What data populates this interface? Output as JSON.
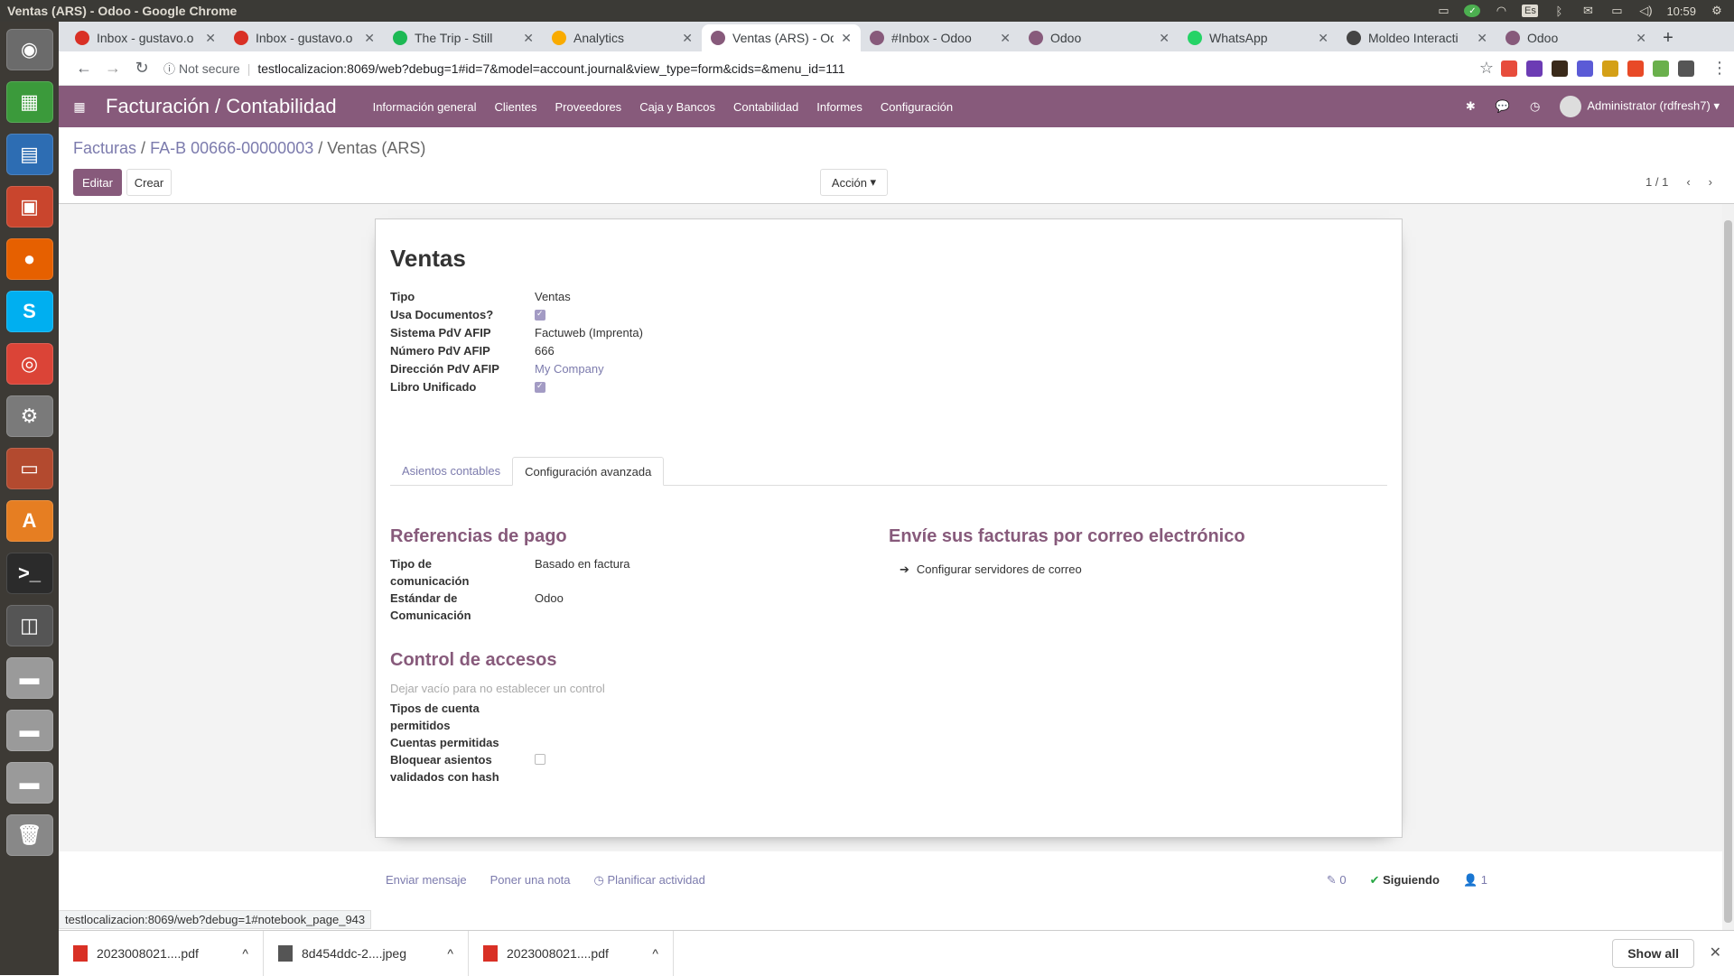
{
  "os": {
    "window_title": "Ventas (ARS) - Odoo - Google Chrome",
    "lang": "Es",
    "clock": "10:59"
  },
  "launcher": {
    "apps": [
      {
        "name": "dash-icon",
        "color": "#6b6b6b",
        "glyph": "◉"
      },
      {
        "name": "calc-icon",
        "color": "#3b9a3b",
        "glyph": "▦"
      },
      {
        "name": "writer-icon",
        "color": "#2d6db3",
        "glyph": "▤"
      },
      {
        "name": "impress-icon",
        "color": "#c9452d",
        "glyph": "▣"
      },
      {
        "name": "firefox-icon",
        "color": "#e66000",
        "glyph": "●"
      },
      {
        "name": "skype-icon",
        "color": "#00aff0",
        "glyph": "S"
      },
      {
        "name": "chrome-icon",
        "color": "#db4437",
        "glyph": "◎"
      },
      {
        "name": "settings-icon",
        "color": "#7a7a7a",
        "glyph": "⚙"
      },
      {
        "name": "files-icon",
        "color": "#b34a2f",
        "glyph": "▭"
      },
      {
        "name": "software-icon",
        "color": "#e67e22",
        "glyph": "A"
      },
      {
        "name": "terminal-icon",
        "color": "#2b2b2b",
        "glyph": ">_"
      },
      {
        "name": "workspace-icon",
        "color": "#555",
        "glyph": "◫"
      },
      {
        "name": "drive1-icon",
        "color": "#9a9a9a",
        "glyph": "▬"
      },
      {
        "name": "drive2-icon",
        "color": "#9a9a9a",
        "glyph": "▬"
      },
      {
        "name": "drive3-icon",
        "color": "#9a9a9a",
        "glyph": "▬"
      },
      {
        "name": "trash-icon",
        "color": "#888",
        "glyph": "🗑"
      }
    ]
  },
  "browser": {
    "tabs": [
      {
        "label": "Inbox - gustavo.o",
        "fav": "gmail-icon",
        "color": "#d93025",
        "active": false
      },
      {
        "label": "Inbox - gustavo.o",
        "fav": "gmail-icon",
        "color": "#d93025",
        "active": false
      },
      {
        "label": "The Trip - Still",
        "fav": "spotify-icon",
        "color": "#1db954",
        "active": false
      },
      {
        "label": "Analytics",
        "fav": "analytics-icon",
        "color": "#f9ab00",
        "active": false
      },
      {
        "label": "Ventas (ARS) - Od",
        "fav": "odoo-icon",
        "color": "#875a7b",
        "active": true
      },
      {
        "label": "#Inbox - Odoo",
        "fav": "odoo-icon",
        "color": "#875a7b",
        "active": false
      },
      {
        "label": "Odoo",
        "fav": "odoo-icon",
        "color": "#875a7b",
        "active": false
      },
      {
        "label": "WhatsApp",
        "fav": "whatsapp-icon",
        "color": "#25d366",
        "active": false
      },
      {
        "label": "Moldeo Interacti",
        "fav": "moldeo-icon",
        "color": "#444",
        "active": false
      },
      {
        "label": "Odoo",
        "fav": "odoo-icon",
        "color": "#875a7b",
        "active": false
      }
    ],
    "security": "Not secure",
    "url": "testlocalizacion:8069/web?debug=1#id=7&model=account.journal&view_type=form&cids=&menu_id=111",
    "extensions": [
      "#e74c3c",
      "#6c3cb4",
      "#3a2a1a",
      "#5b5bd6",
      "#d4a017",
      "#e84a27",
      "#6ab04c",
      "#555"
    ]
  },
  "odoo": {
    "app_name": "Facturación / Contabilidad",
    "menus": [
      "Información general",
      "Clientes",
      "Proveedores",
      "Caja y Bancos",
      "Contabilidad",
      "Informes",
      "Configuración"
    ],
    "user": "Administrator (rdfresh7)",
    "breadcrumb": {
      "c1": "Facturas",
      "c2": "FA-B 00666-00000003",
      "c3": "Ventas (ARS)",
      "sep": "/"
    },
    "buttons": {
      "edit": "Editar",
      "create": "Crear",
      "action": "Acción"
    },
    "pager": "1 / 1"
  },
  "record": {
    "title": "Ventas",
    "fields": [
      {
        "label": "Tipo",
        "value": "Ventas",
        "kind": "text"
      },
      {
        "label": "Usa Documentos?",
        "value": "",
        "kind": "check_on"
      },
      {
        "label": "Sistema PdV AFIP",
        "value": "Factuweb (Imprenta)",
        "kind": "text"
      },
      {
        "label": "Número PdV AFIP",
        "value": "666",
        "kind": "text"
      },
      {
        "label": "Dirección PdV AFIP",
        "value": "My Company",
        "kind": "link"
      },
      {
        "label": "Libro Unificado",
        "value": "",
        "kind": "check_on"
      }
    ],
    "tabs": [
      "Asientos contables",
      "Configuración avanzada"
    ],
    "active_tab": 1,
    "payment_refs": {
      "title": "Referencias de pago",
      "f1_label_a": "Tipo de",
      "f1_label_b": "comunicación",
      "f1_value": "Basado en factura",
      "f2_label_a": "Estándar de",
      "f2_label_b": "Comunicación",
      "f2_value": "Odoo"
    },
    "email_section": {
      "title": "Envíe sus facturas por correo electrónico",
      "link": "Configurar servidores de correo"
    },
    "access": {
      "title": "Control de accesos",
      "help": "Dejar vacío para no establecer un control",
      "f1_a": "Tipos de cuenta",
      "f1_b": "permitidos",
      "f2": "Cuentas permitidas",
      "f3_a": "Bloquear asientos",
      "f3_b": "validados con hash"
    }
  },
  "chatter": {
    "send": "Enviar mensaje",
    "note": "Poner una nota",
    "activity": "Planificar actividad",
    "attachments": "0",
    "following": "Siguiendo",
    "followers": "1"
  },
  "status_url": "testlocalizacion:8069/web?debug=1#notebook_page_943",
  "downloads": {
    "items": [
      {
        "name": "2023008021....pdf",
        "icon": "pdf-icon"
      },
      {
        "name": "8d454ddc-2....jpeg",
        "icon": "image-icon"
      },
      {
        "name": "2023008021....pdf",
        "icon": "pdf-icon"
      }
    ],
    "show_all": "Show all"
  }
}
